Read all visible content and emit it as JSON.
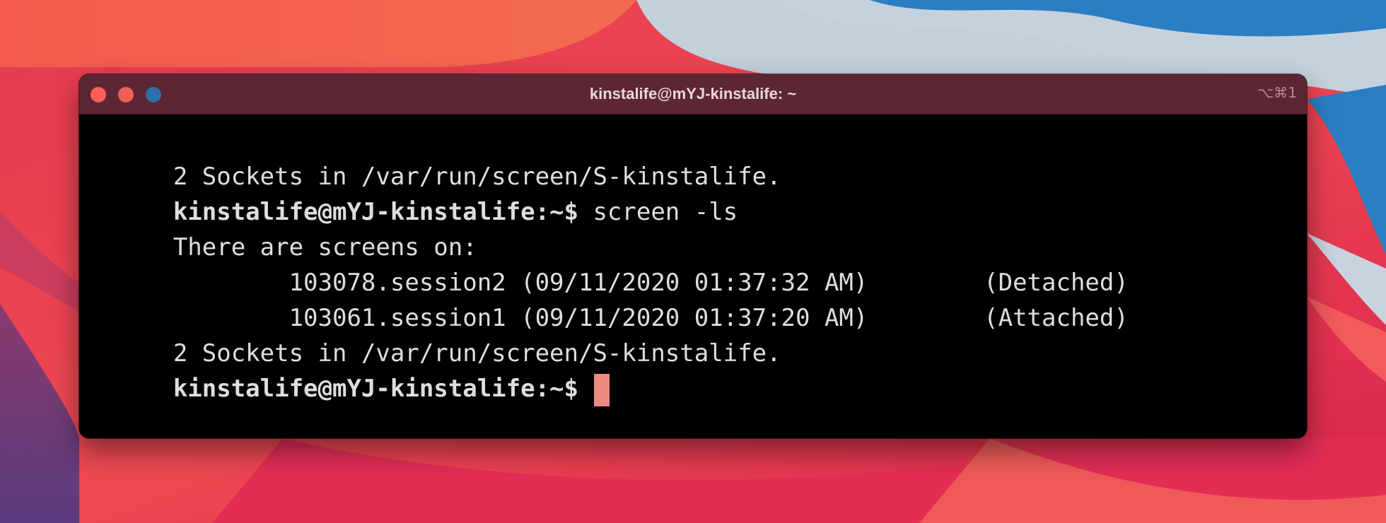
{
  "window": {
    "title": "kinstalife@mYJ-kinstalife: ~",
    "shortcut": "⌥⌘1",
    "controls": [
      "close",
      "minimize",
      "zoom"
    ]
  },
  "terminal": {
    "lines": [
      {
        "text": "2 Sockets in /var/run/screen/S-kinstalife."
      },
      {
        "prompt": "kinstalife@mYJ-kinstalife:~$",
        "command": " screen -ls"
      },
      {
        "text": "There are screens on:"
      },
      {
        "text": "        103078.session2 (09/11/2020 01:37:32 AM)        (Detached)"
      },
      {
        "text": "        103061.session1 (09/11/2020 01:37:20 AM)        (Attached)"
      },
      {
        "text": "2 Sockets in /var/run/screen/S-kinstalife."
      },
      {
        "prompt": "kinstalife@mYJ-kinstalife:~$",
        "command": " "
      }
    ]
  },
  "colors": {
    "titlebar": "#5c2634",
    "terminal_bg": "#000000",
    "text": "#dedede",
    "cursor": "#ee8a82"
  }
}
